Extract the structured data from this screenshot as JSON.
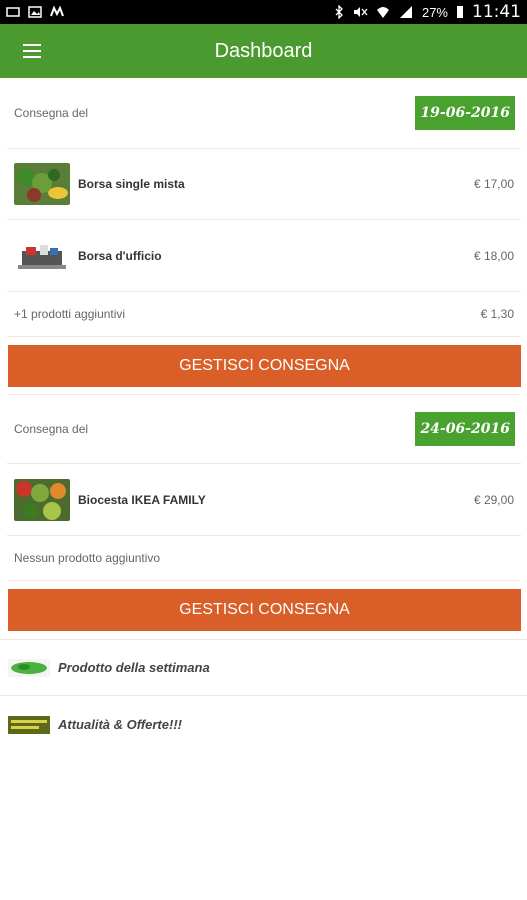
{
  "status_bar": {
    "battery": "27%",
    "time": "11:41"
  },
  "app_bar": {
    "title": "Dashboard",
    "menu_icon": "hamburger-menu-icon"
  },
  "deliveries": [
    {
      "date_label": "Consegna del",
      "date": "19-06-2016",
      "products": [
        {
          "name": "Borsa single mista",
          "price": "€ 17,00"
        },
        {
          "name": "Borsa d'ufficio",
          "price": "€ 18,00"
        }
      ],
      "extra_label": "+1 prodotti aggiuntivi",
      "extra_price": "€ 1,30",
      "button": "GESTISCI CONSEGNA"
    },
    {
      "date_label": "Consegna del",
      "date": "24-06-2016",
      "products": [
        {
          "name": "Biocesta IKEA FAMILY",
          "price": "€ 29,00"
        }
      ],
      "extra_label": "Nessun prodotto aggiuntivo",
      "button": "GESTISCI CONSEGNA"
    }
  ],
  "promos": [
    {
      "label": "Prodotto della settimana"
    },
    {
      "label": "Attualità & Offerte!!!"
    }
  ],
  "colors": {
    "app_bar": "#4a9a30",
    "date_badge": "#49a22f",
    "button": "#d95e27"
  }
}
